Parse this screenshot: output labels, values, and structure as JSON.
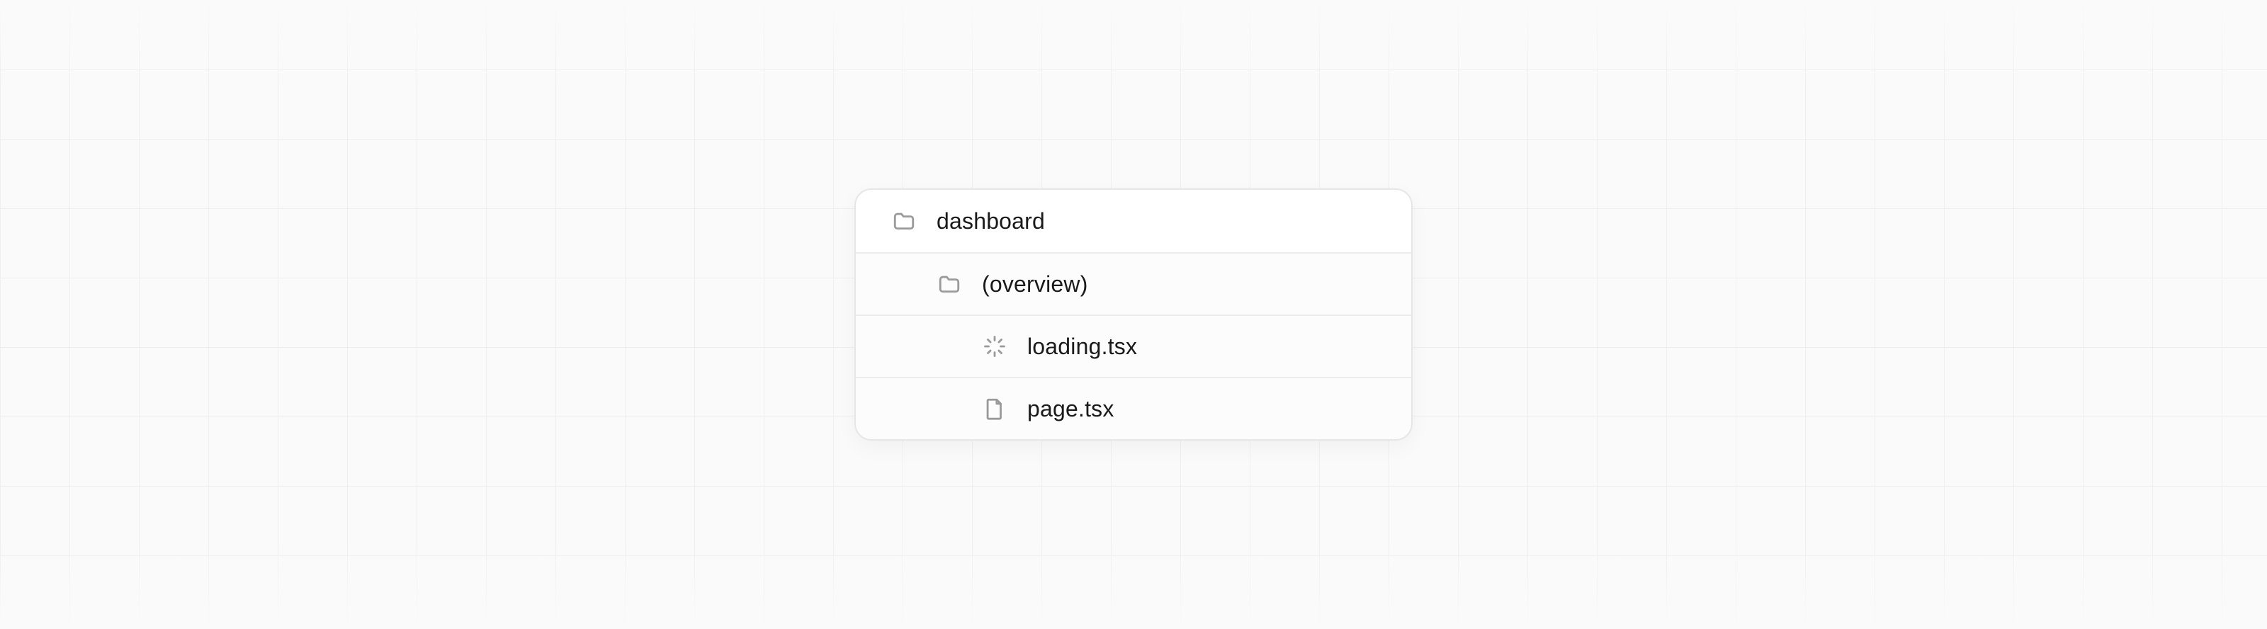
{
  "tree": {
    "root": {
      "name": "dashboard",
      "kind": "folder"
    },
    "children": [
      {
        "name": "(overview)",
        "kind": "folder",
        "children": [
          {
            "name": "loading.tsx",
            "kind": "loading-file"
          },
          {
            "name": "page.tsx",
            "kind": "page-file"
          }
        ]
      }
    ]
  },
  "colors": {
    "panel_bg": "#ffffff",
    "row_bg": "#fcfcfc",
    "border": "#e6e6e6",
    "divider": "#ececec",
    "text": "#1a1a1a",
    "icon": "#9a9a9a",
    "canvas": "#fafafa",
    "grid": "#efefef"
  }
}
